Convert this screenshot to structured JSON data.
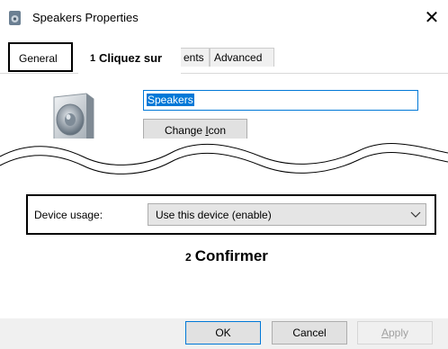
{
  "window": {
    "title": "Speakers Properties",
    "close_glyph": "✕",
    "app_icon": "speaker-app-icon"
  },
  "tabs": {
    "general": "General",
    "hidden_partial": "ents",
    "advanced": "Advanced"
  },
  "callout1": {
    "number": "1",
    "text": "Cliquez sur"
  },
  "general": {
    "device_name": "Speakers",
    "change_icon": {
      "before": "Change ",
      "underline": "I",
      "after": "con"
    }
  },
  "device_usage": {
    "label": "Device usage:",
    "selected": "Use this device (enable)"
  },
  "callout2": {
    "number": "2",
    "text": "Confirmer"
  },
  "buttons": {
    "ok": "OK",
    "cancel": "Cancel",
    "apply": {
      "underline": "A",
      "rest": "pply"
    }
  },
  "colors": {
    "accent": "#0078d7",
    "button_face": "#e1e1e1",
    "disabled_text": "#a0a0a0"
  }
}
